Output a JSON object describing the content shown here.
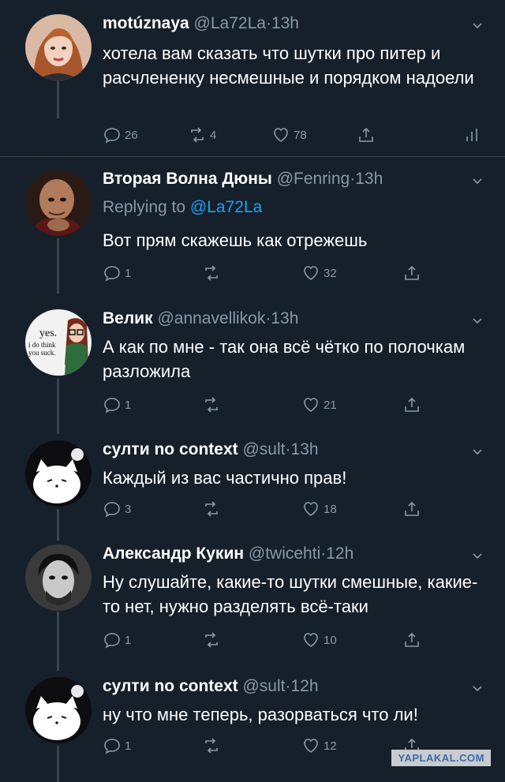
{
  "tweets": [
    {
      "name": "motúznaya",
      "handle": "@La72La",
      "time": "13h",
      "text": "хотела вам сказать что шутки про питер и расчлененку несмешные и порядком надоели",
      "replies": "26",
      "retweets": "4",
      "likes": "78"
    },
    {
      "name": "Вторая Волна Дюны",
      "handle": "@Fenring",
      "time": "13h",
      "replying_label": "Replying to",
      "replying_handle": "@La72La",
      "text": "Вот прям скажешь как отрежешь",
      "replies": "1",
      "retweets": "",
      "likes": "32"
    },
    {
      "name": "Велик",
      "handle": "@annavellikok",
      "time": "13h",
      "text": "А как по мне - так она всё чётко по полочкам разложила",
      "replies": "1",
      "retweets": "",
      "likes": "21",
      "avatar_text": [
        "yes.",
        "i do think",
        "you suck."
      ]
    },
    {
      "name": "султи no context",
      "handle": "@sult",
      "time": "13h",
      "text": "Каждый из вас частично прав!",
      "replies": "3",
      "retweets": "",
      "likes": "18"
    },
    {
      "name": "Александр Кукин",
      "handle": "@twicehti",
      "time": "12h",
      "text": "Ну слушайте, какие-то шутки смешные, какие-то нет, нужно разделять всё-таки",
      "replies": "1",
      "retweets": "",
      "likes": "10"
    },
    {
      "name": "султи no context",
      "handle": "@sult",
      "time": "12h",
      "text": "ну что мне теперь, разорваться что ли!",
      "replies": "1",
      "retweets": "",
      "likes": "12"
    }
  ],
  "separator": "·",
  "watermark": "YAPLAKAL.COM",
  "colors": {
    "background": "#15202b",
    "text": "#ffffff",
    "secondary": "#8899a6",
    "link": "#1da1f2",
    "divider": "#38444d"
  }
}
